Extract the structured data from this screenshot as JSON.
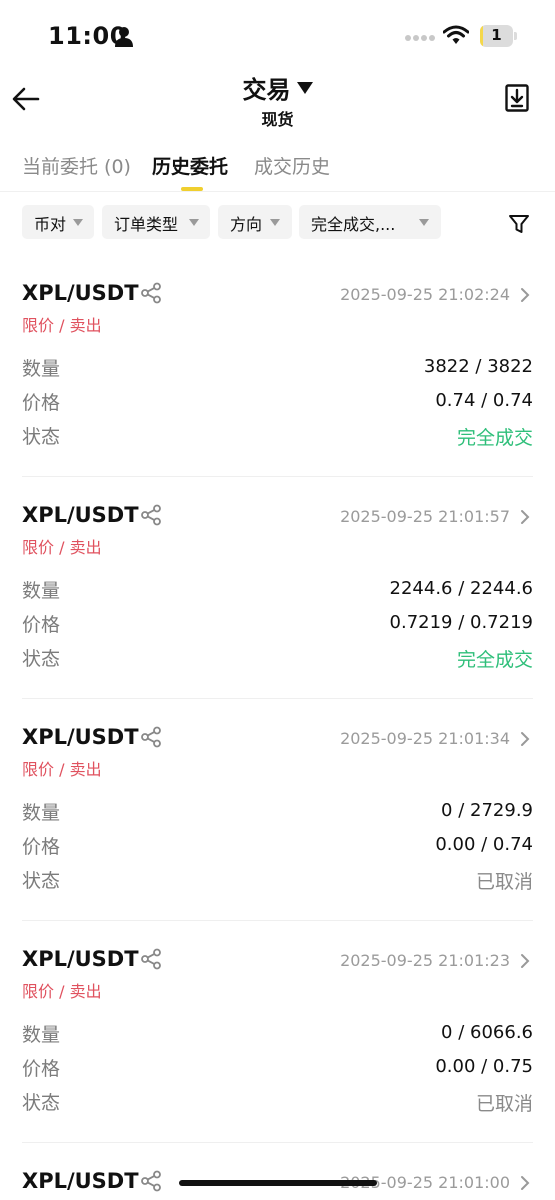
{
  "status_bar": {
    "time": "11:00",
    "battery_level": "1",
    "battery_fraction": 0.1
  },
  "header": {
    "title": "交易",
    "subtitle": "现货"
  },
  "tabs": [
    {
      "label": "当前委托 (0)",
      "active": false
    },
    {
      "label": "历史委托",
      "active": true
    },
    {
      "label": "成交历史",
      "active": false
    }
  ],
  "filters": [
    {
      "label": "币对"
    },
    {
      "label": "订单类型"
    },
    {
      "label": "方向"
    },
    {
      "label": "完全成交,..."
    }
  ],
  "row_labels": {
    "quantity": "数量",
    "price": "价格",
    "status": "状态"
  },
  "orders": [
    {
      "pair": "XPL/USDT",
      "time": "2025-09-25 21:02:24",
      "type": "限价 / 卖出",
      "quantity": "3822 / 3822",
      "price": "0.74 / 0.74",
      "status": "完全成交"
    },
    {
      "pair": "XPL/USDT",
      "time": "2025-09-25 21:01:57",
      "type": "限价 / 卖出",
      "quantity": "2244.6 / 2244.6",
      "price": "0.7219 / 0.7219",
      "status": "完全成交"
    },
    {
      "pair": "XPL/USDT",
      "time": "2025-09-25 21:01:34",
      "type": "限价 / 卖出",
      "quantity": "0 / 2729.9",
      "price": "0.00 / 0.74",
      "status": "已取消"
    },
    {
      "pair": "XPL/USDT",
      "time": "2025-09-25 21:01:23",
      "type": "限价 / 卖出",
      "quantity": "0 / 6066.6",
      "price": "0.00 / 0.75",
      "status": "已取消"
    }
  ],
  "partial_order": {
    "pair": "XPL/USDT",
    "time": "2025-09-25 21:01:00"
  },
  "colors": {
    "accent": "#f0cf2f",
    "sell": "#e0525f",
    "filled": "#2fbf7a",
    "cancelled": "#8a8a8a"
  }
}
